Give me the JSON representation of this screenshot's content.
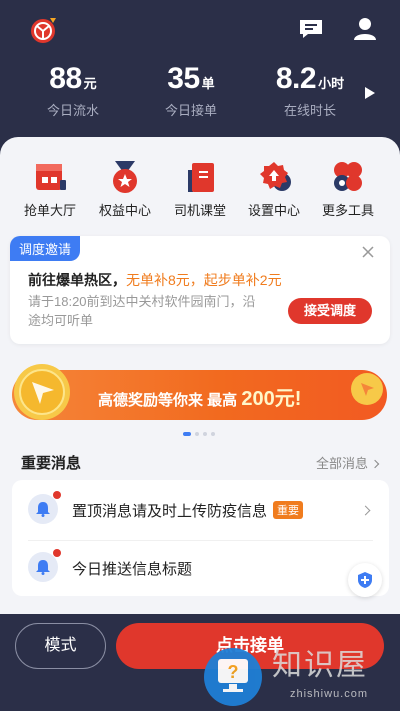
{
  "header": {
    "stats": [
      {
        "value": "88",
        "unit": "元",
        "label": "今日流水"
      },
      {
        "value": "35",
        "unit": "单",
        "label": "今日接单"
      },
      {
        "value": "8.2",
        "unit": "小时",
        "label": "在线时长"
      }
    ]
  },
  "menu": [
    {
      "label": "抢单大厅",
      "icon": "order-hall-icon"
    },
    {
      "label": "权益中心",
      "icon": "medal-icon"
    },
    {
      "label": "司机课堂",
      "icon": "book-icon"
    },
    {
      "label": "设置中心",
      "icon": "gear-icon"
    },
    {
      "label": "更多工具",
      "icon": "more-tools-icon"
    }
  ],
  "dispatch": {
    "tag": "调度邀请",
    "headline": "前往爆单热区，",
    "highlight": "无单补8元，起步单补2元",
    "desc": "请于18:20前到达中关村软件园南门，沿途均可听单",
    "accept": "接受调度"
  },
  "banner": {
    "text": "高德奖励等你来 最高",
    "amount": "200元!"
  },
  "messages": {
    "title": "重要消息",
    "more": "全部消息",
    "items": [
      {
        "text": "置顶消息请及时上传防疫信息",
        "badge": "重要"
      },
      {
        "text": "今日推送信息标题",
        "badge": ""
      }
    ]
  },
  "bottom": {
    "mode": "模式",
    "go": "点击接单"
  },
  "watermark": {
    "text": "知识屋",
    "sub": "zhishiwu.com"
  },
  "colors": {
    "header_bg": "#2b2f48",
    "accent_red": "#e0372c",
    "accent_orange": "#f07c1e",
    "tag_blue": "#3e7cf3"
  }
}
